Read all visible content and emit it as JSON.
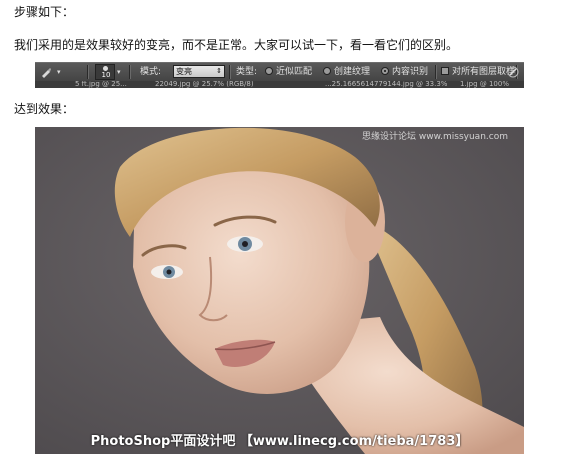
{
  "text": {
    "line1": "步骤如下：",
    "line2": "我们采用的是效果较好的变亮，而不是正常。大家可以试一下，看一看它们的区别。",
    "line3": "达到效果："
  },
  "toolbar": {
    "brush_size": "10",
    "mode_label": "模式:",
    "mode_value": "变亮",
    "type_label": "类型:",
    "radio_1": "近似匹配",
    "radio_2": "创建纹理",
    "radio_3": "内容识别",
    "checkbox_label": "对所有图层取样",
    "selected_radio": "内容识别"
  },
  "tabs": {
    "tab1": "5 ft.jpg  @ 25...",
    "tab2": "22049.jpg  @ 25.7% (RGB/8)",
    "tab3": "...25.1665614779144.jpg @ 33.3%",
    "tab4": "1.jpg @ 100%"
  },
  "photo": {
    "watermark_top": "思缘设计论坛 www.missyuan.com",
    "caption": "PhotoShop平面设计吧 【www.linecg.com/tieba/1783】"
  },
  "colors": {
    "toolbar_bg": "#4b4b4b",
    "photo_bg": "#5a5659"
  }
}
